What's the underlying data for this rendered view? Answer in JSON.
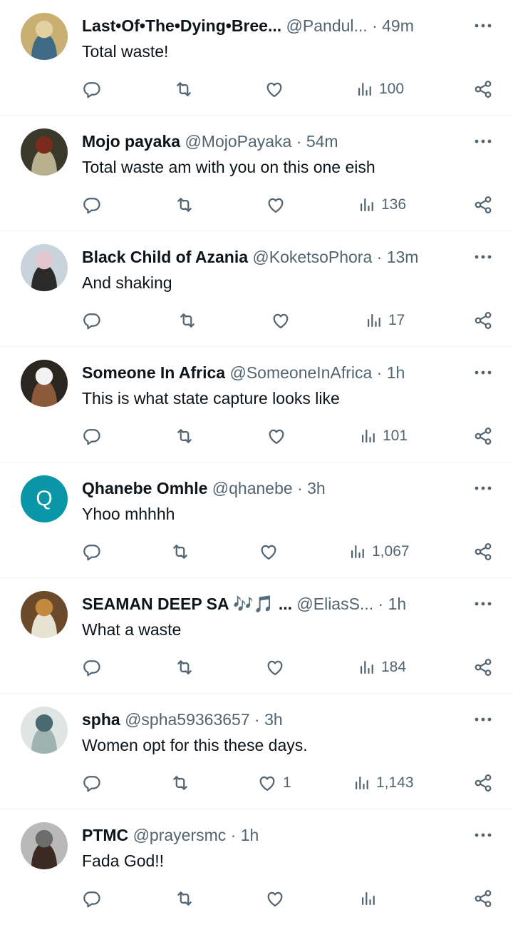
{
  "tweets": [
    {
      "name": "Last•Of•The•Dying•Bree...",
      "handle": "@Pandul...",
      "time": "49m",
      "text": "Total waste!",
      "likes": "",
      "views": "100",
      "avatar_colors": [
        "#c9b072",
        "#3f6a86",
        "#e3d1a2"
      ]
    },
    {
      "name": "Mojo payaka",
      "handle": "@MojoPayaka",
      "time": "54m",
      "text": "Total waste am with you on this one eish",
      "likes": "",
      "views": "136",
      "avatar_colors": [
        "#3b3a2a",
        "#b9b08f",
        "#7a2b1c"
      ]
    },
    {
      "name": "Black Child of Azania",
      "handle": "@KoketsoPhora",
      "time": "13m",
      "text": "And shaking",
      "likes": "",
      "views": "17",
      "avatar_colors": [
        "#c8d3db",
        "#2a2a2a",
        "#e4c6cf"
      ]
    },
    {
      "name": "Someone In Africa",
      "handle": "@SomeoneInAfrica",
      "time": "1h",
      "text": "This is what state capture looks like",
      "likes": "",
      "views": "101",
      "avatar_colors": [
        "#2c2620",
        "#8a5a3a",
        "#f2f2f2"
      ]
    },
    {
      "name": "Qhanebe Omhle",
      "handle": "@qhanebe",
      "time": "3h",
      "text": "Yhoo mhhhh",
      "likes": "",
      "views": "1,067",
      "avatar_letter": "Q",
      "avatar_colors": [
        "#0996a6",
        "#0996a6",
        "#0996a6"
      ]
    },
    {
      "name": "SEAMAN DEEP SA 🎶🎵 ...",
      "handle": "@EliasS...",
      "time": "1h",
      "text": "What a waste",
      "likes": "",
      "views": "184",
      "avatar_colors": [
        "#6b4a2c",
        "#e8e2d2",
        "#c3893e"
      ]
    },
    {
      "name": "spha",
      "handle": "@spha59363657",
      "time": "3h",
      "text": "Women opt for this these days.",
      "likes": "1",
      "views": "1,143",
      "avatar_colors": [
        "#dfe5e2",
        "#9fb4b0",
        "#4a6a72"
      ]
    },
    {
      "name": "PTMC",
      "handle": "@prayersmc",
      "time": "1h",
      "text": "Fada God!!",
      "likes": "",
      "views": "",
      "avatar_colors": [
        "#b9b9b9",
        "#3a2a22",
        "#6c6c6c"
      ]
    }
  ],
  "icons": {
    "reply": "reply-icon",
    "retweet": "retweet-icon",
    "like": "like-icon",
    "views": "views-icon",
    "share": "share-icon",
    "more": "more-icon"
  },
  "colors": {
    "text": "#0f1419",
    "secondary": "#536471",
    "divider": "#eff3f4"
  }
}
